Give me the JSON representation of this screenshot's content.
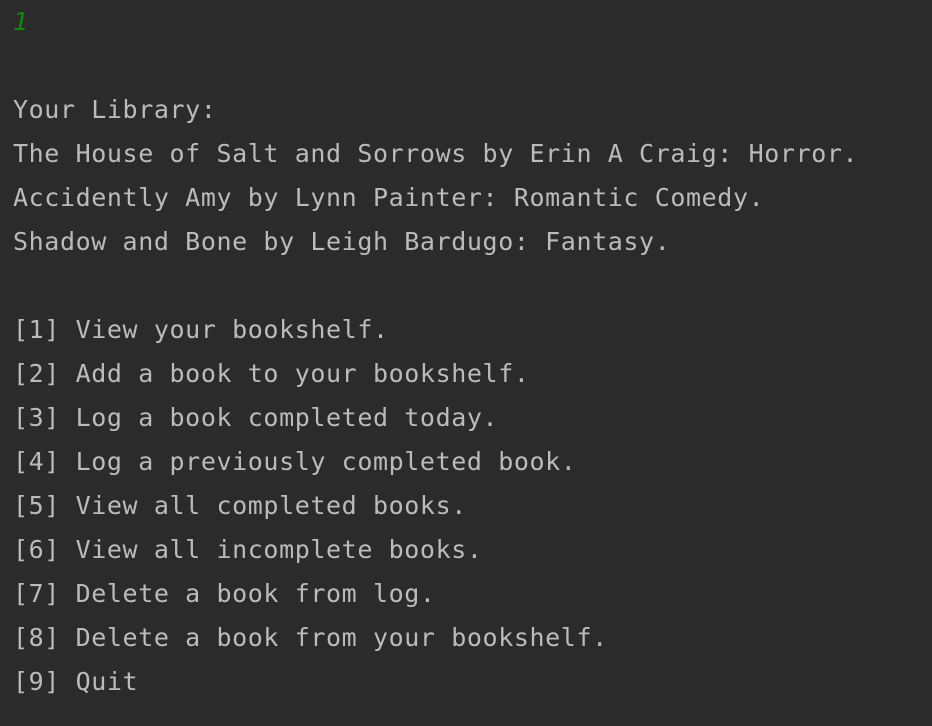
{
  "console": {
    "input_echo": "1",
    "library_heading": "Your Library:",
    "library_entries": [
      "The House of Salt and Sorrows by Erin A Craig: Horror.",
      "Accidently Amy by Lynn Painter: Romantic Comedy.",
      "Shadow and Bone by Leigh Bardugo: Fantasy."
    ],
    "menu_options": [
      "[1] View your bookshelf.",
      "[2] Add a book to your bookshelf.",
      "[3] Log a book completed today.",
      "[4] Log a previously completed book.",
      "[5] View all completed books.",
      "[6] View all incomplete books.",
      "[7] Delete a book from log.",
      "[8] Delete a book from your bookshelf.",
      "[9] Quit"
    ]
  },
  "colors": {
    "background": "#2b2b2b",
    "text": "#bbbbbb",
    "input_echo": "#0b8a0b"
  }
}
